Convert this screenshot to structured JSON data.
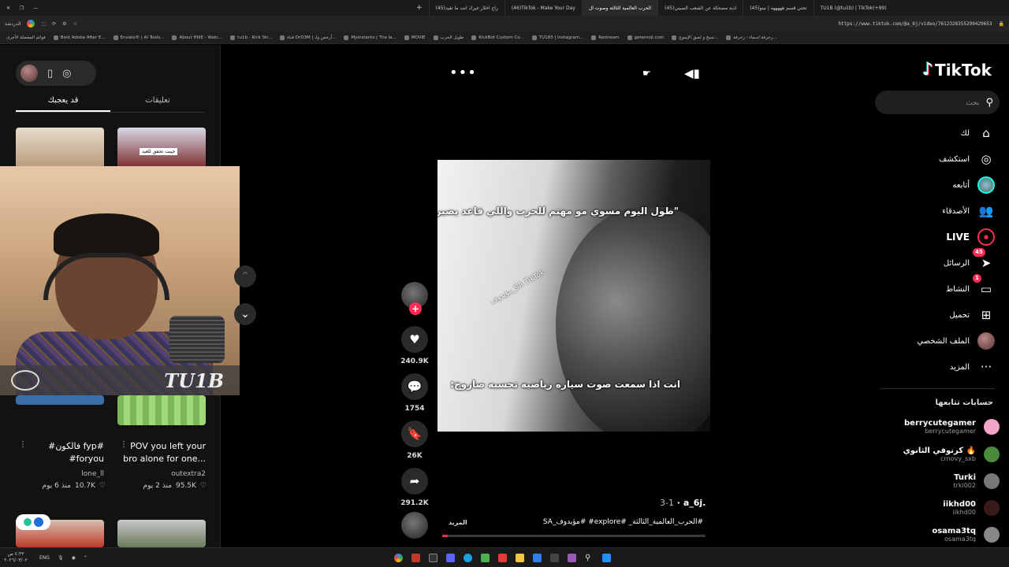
{
  "browser": {
    "tabs": [
      {
        "label": "TU1B (@tu1b) | TikTok(+99)",
        "active": false
      },
      {
        "label": "(45)تحتي قسم هههههه | تيتو",
        "active": false
      },
      {
        "label": "(45)اذية مضحكة عن الشعب الصيني",
        "active": false
      },
      {
        "label": "الحرب العالمية الثالثة وصوت ال",
        "active": true
      },
      {
        "label": "(46)TikTok - Make Your Day",
        "active": false
      },
      {
        "label": "(45)راح اخلاز غيرك انت ما تقيد",
        "active": false
      }
    ],
    "url": "https://www.tiktok.com/@a_6j/video/7612328355299429653",
    "profile_label": "الدردشة",
    "bookmarks": [
      "قوائم المفضلة الأخرى",
      "Best Adobe After E...",
      "Envato® | AI Tools...",
      "About HIIIE - Watc...",
      "tu1b - Kick Str...",
      "قناة DrD3M | أرخص ولـ...",
      "Myinstants | The la...",
      "MOVIE",
      "طويل الحرب",
      "KickBot Custom Co...",
      "TU183 | Instagram...",
      "Restream",
      "getemoji.com",
      "نسخ و لصق الإيموج...",
      "زخرفة اسماء - زخرفة..."
    ]
  },
  "left_panel": {
    "tabs": [
      {
        "label": "قد يعجبك",
        "active": true
      },
      {
        "label": "تعليقات",
        "active": false
      }
    ],
    "videos": [
      {
        "title": "#فالكون fyp#\n#foryou",
        "author": "lone_ll",
        "likes": "10.7K",
        "age": "منذ 6 يوم"
      },
      {
        "title": "POV you left your\nbro alone for one...",
        "author": "outextra2",
        "likes": "95.5K",
        "age": "منذ 2 يوم"
      }
    ],
    "thumb_caption": "جيبت تحقق للعيد"
  },
  "webcam": {
    "overlay_text": "TU1B"
  },
  "video": {
    "top_caption": "\"طول اليوم مسوي مو مهتم للحرب واللي قاعد يصير\"",
    "bottom_caption": "انت اذا سمعت صوت سياره رياضيه تحسبه صاروخ:",
    "watermark": "مؤيدوف_SA TikTok",
    "username": "a_6j.",
    "date": "3-1",
    "description": "#الحرب_العالمية_الثالثة_ #explore# #مؤيدوف_SA",
    "more_label": "المزيد",
    "progress": 0.02,
    "actions": {
      "likes": "240.9K",
      "comments": "1754",
      "saves": "26K",
      "shares": "291.2K"
    }
  },
  "sidebar": {
    "logo": "TikTok",
    "search_placeholder": "بحث",
    "nav": [
      {
        "label": "لك",
        "icon": "home-icon",
        "glyph": "⌂"
      },
      {
        "label": "استكشف",
        "icon": "compass-icon",
        "glyph": "◎"
      },
      {
        "label": "أتابعه",
        "icon": "following-avatar-icon",
        "glyph": ""
      },
      {
        "label": "الأصدقاء",
        "icon": "friends-icon",
        "glyph": "👥"
      },
      {
        "label": "LIVE",
        "icon": "live-icon",
        "glyph": "●"
      },
      {
        "label": "الرسائل",
        "icon": "messages-icon",
        "glyph": "➤",
        "badge": "45"
      },
      {
        "label": "النشاط",
        "icon": "activity-icon",
        "glyph": "▭",
        "badge": "1"
      },
      {
        "label": "تحميل",
        "icon": "upload-icon",
        "glyph": "⊞"
      },
      {
        "label": "الملف الشخصي",
        "icon": "profile-avatar-icon",
        "glyph": ""
      },
      {
        "label": "المزيد",
        "icon": "more-icon",
        "glyph": "···"
      }
    ],
    "following_title": "حسابات تتابعها",
    "following": [
      {
        "name": "berrycutegamer",
        "handle": "berrycutegamer",
        "color": "#f4a6c8"
      },
      {
        "name": "كرنوفي الثانوي 🔥",
        "handle": "crnovy_sxb",
        "color": "#4a8a3a"
      },
      {
        "name": "Turki",
        "handle": "trki002",
        "color": "#777777"
      },
      {
        "name": "iikhd00",
        "handle": "iikhd00",
        "color": "#3a1a1a"
      },
      {
        "name": "osama3tq",
        "handle": "osama3tq",
        "color": "#888888"
      }
    ]
  },
  "taskbar": {
    "language": "ENG",
    "time": "٤:٣٣ ص",
    "date": "٢٠٢٦/٠٣/٠٢"
  }
}
